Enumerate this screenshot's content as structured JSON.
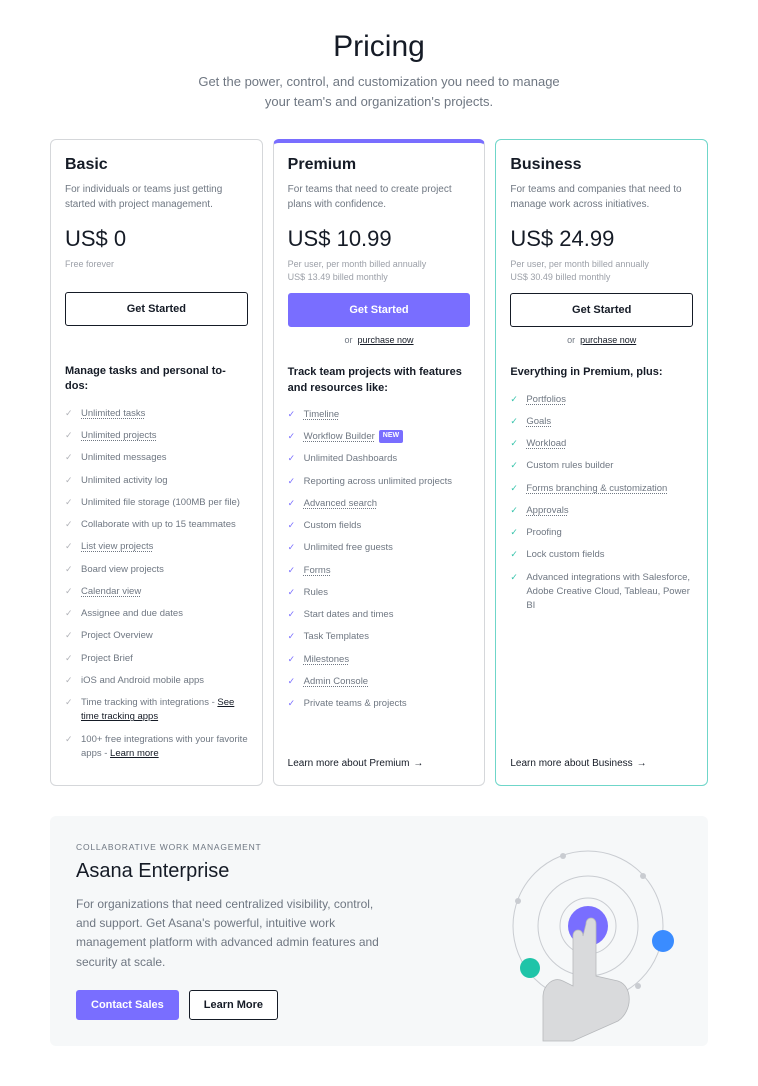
{
  "heading": {
    "title": "Pricing",
    "subtitle_l1": "Get the power, control, and customization you need to manage",
    "subtitle_l2": "your team's and organization's projects."
  },
  "plans": {
    "basic": {
      "name": "Basic",
      "desc": "For individuals or teams just getting started with project management.",
      "price": "US$ 0",
      "price_note": "Free forever",
      "cta": "Get Started",
      "features_title": "Manage tasks and personal to-dos:",
      "features": [
        {
          "label": "Unlimited tasks",
          "link": true
        },
        {
          "label": "Unlimited projects",
          "link": true
        },
        {
          "label": "Unlimited messages"
        },
        {
          "label": "Unlimited activity log"
        },
        {
          "label": "Unlimited file storage (100MB per file)"
        },
        {
          "label": "Collaborate with up to 15 teammates"
        },
        {
          "label": "List view projects",
          "link": true
        },
        {
          "label": "Board view projects"
        },
        {
          "label": "Calendar view",
          "link": true
        },
        {
          "label": "Assignee and due dates"
        },
        {
          "label": "Project Overview"
        },
        {
          "label": "Project Brief"
        },
        {
          "label": "iOS and Android mobile apps"
        },
        {
          "label": "Time tracking with integrations - ",
          "suffix_link": "See time tracking apps"
        },
        {
          "label": "100+ free integrations with your favorite apps - ",
          "suffix_link": "Learn more"
        }
      ]
    },
    "premium": {
      "name": "Premium",
      "desc": "For teams that need to create project plans with confidence.",
      "price": "US$ 10.99",
      "price_note_l1": "Per user, per month billed annually",
      "price_note_l2": "US$ 13.49 billed monthly",
      "cta": "Get Started",
      "purchase_or": "or",
      "purchase_now": "purchase now",
      "features_title": "Track team projects with features and resources like:",
      "features": [
        {
          "label": "Timeline",
          "link": true
        },
        {
          "label": "Workflow Builder",
          "link": true,
          "badge": "NEW"
        },
        {
          "label": "Unlimited Dashboards"
        },
        {
          "label": "Reporting across unlimited projects"
        },
        {
          "label": "Advanced search",
          "link": true
        },
        {
          "label": "Custom fields"
        },
        {
          "label": "Unlimited free guests"
        },
        {
          "label": "Forms",
          "link": true
        },
        {
          "label": "Rules"
        },
        {
          "label": "Start dates and times"
        },
        {
          "label": "Task Templates"
        },
        {
          "label": "Milestones",
          "link": true
        },
        {
          "label": "Admin Console",
          "link": true
        },
        {
          "label": "Private teams & projects"
        }
      ],
      "learn_more": "Learn more about Premium"
    },
    "business": {
      "name": "Business",
      "desc": "For teams and companies that need to manage work across initiatives.",
      "price": "US$ 24.99",
      "price_note_l1": "Per user, per month billed annually",
      "price_note_l2": "US$ 30.49 billed monthly",
      "cta": "Get Started",
      "purchase_or": "or",
      "purchase_now": "purchase now",
      "features_title": "Everything in Premium, plus:",
      "features": [
        {
          "label": "Portfolios",
          "link": true
        },
        {
          "label": "Goals",
          "link": true
        },
        {
          "label": "Workload",
          "link": true
        },
        {
          "label": "Custom rules builder"
        },
        {
          "label": "Forms branching & customization",
          "link": true
        },
        {
          "label": "Approvals",
          "link": true
        },
        {
          "label": "Proofing"
        },
        {
          "label": "Lock custom fields"
        },
        {
          "label": "Advanced integrations with Salesforce, Adobe Creative Cloud, Tableau, Power BI"
        }
      ],
      "learn_more": "Learn more about Business"
    }
  },
  "enterprise": {
    "eyebrow": "COLLABORATIVE WORK MANAGEMENT",
    "title": "Asana Enterprise",
    "desc": "For organizations that need centralized visibility, control, and support. Get Asana's powerful, intuitive work management platform with advanced admin features and security at scale.",
    "contact": "Contact Sales",
    "learn": "Learn More"
  }
}
